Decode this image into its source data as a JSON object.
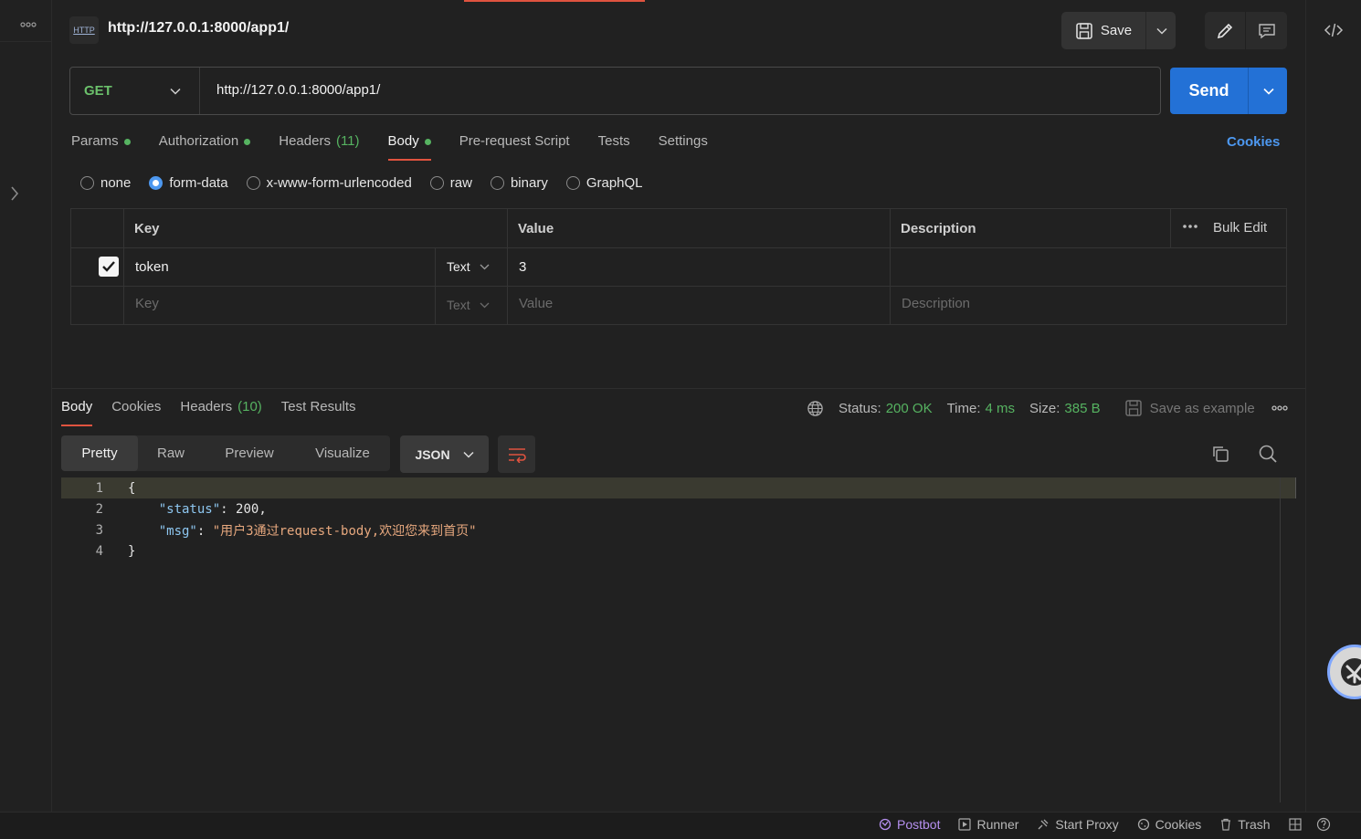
{
  "header": {
    "http_badge": "HTTP",
    "title": "http://127.0.0.1:8000/app1/",
    "save_label": "Save"
  },
  "request": {
    "method": "GET",
    "url": "http://127.0.0.1:8000/app1/",
    "send_label": "Send"
  },
  "req_tabs": {
    "params": "Params",
    "authorization": "Authorization",
    "headers": "Headers",
    "headers_count": "(11)",
    "body": "Body",
    "prerequest": "Pre-request Script",
    "tests": "Tests",
    "settings": "Settings",
    "cookies": "Cookies"
  },
  "body_types": {
    "none": "none",
    "form_data": "form-data",
    "urlencoded": "x-www-form-urlencoded",
    "raw": "raw",
    "binary": "binary",
    "graphql": "GraphQL",
    "selected": "form-data"
  },
  "form_table": {
    "col_key": "Key",
    "col_value": "Value",
    "col_description": "Description",
    "bulk_edit": "Bulk Edit",
    "rows": [
      {
        "checked": true,
        "key": "token",
        "type": "Text",
        "value": "3",
        "description": ""
      }
    ],
    "empty_row": {
      "key_placeholder": "Key",
      "type": "Text",
      "value_placeholder": "Value",
      "description_placeholder": "Description"
    }
  },
  "response": {
    "tabs": {
      "body": "Body",
      "cookies": "Cookies",
      "headers": "Headers",
      "headers_count": "(10)",
      "test_results": "Test Results"
    },
    "status_label": "Status:",
    "status_value": "200 OK",
    "time_label": "Time:",
    "time_value": "4 ms",
    "size_label": "Size:",
    "size_value": "385 B",
    "save_example": "Save as example",
    "views": {
      "pretty": "Pretty",
      "raw": "Raw",
      "preview": "Preview",
      "visualize": "Visualize"
    },
    "format": "JSON",
    "code_lines": [
      {
        "num": "1",
        "text": "{"
      },
      {
        "num": "2",
        "key": "\"status\"",
        "sep": ": ",
        "value": "200",
        "tail": ","
      },
      {
        "num": "3",
        "key": "\"msg\"",
        "sep": ": ",
        "str": "\"用户3通过request-body,欢迎您来到首页\""
      },
      {
        "num": "4",
        "text": "}"
      }
    ]
  },
  "footer": {
    "postbot": "Postbot",
    "runner": "Runner",
    "start_proxy": "Start Proxy",
    "cookies": "Cookies",
    "trash": "Trash"
  },
  "colors": {
    "accent": "#e0533f",
    "send": "#2371d6",
    "method_get": "#6bc06b",
    "status_ok": "#56b361",
    "link": "#4d98f0"
  }
}
